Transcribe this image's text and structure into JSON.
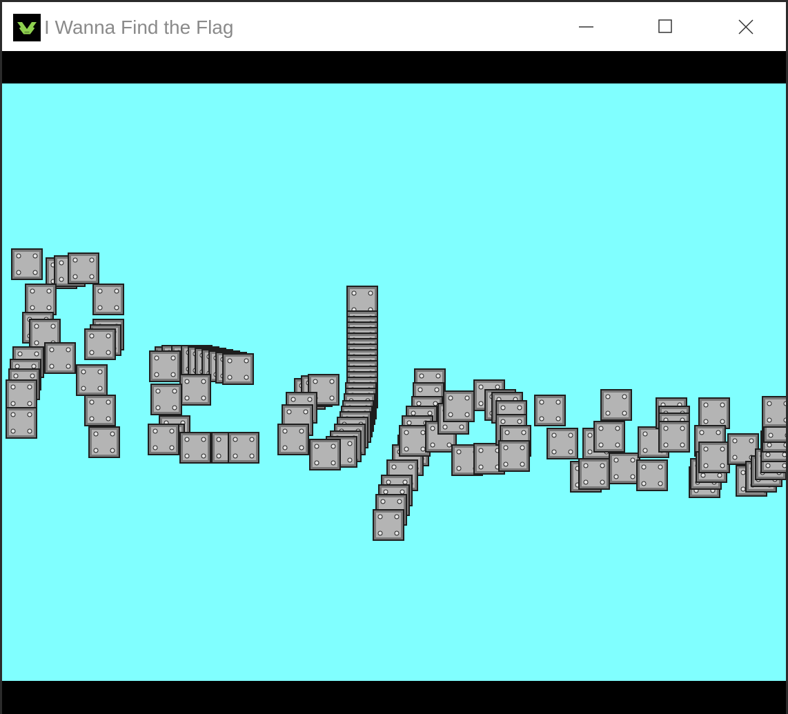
{
  "window": {
    "title": "I Wanna Find the Flag",
    "icon": "gamemaker-icon",
    "controls": [
      "minimize-icon",
      "maximize-icon",
      "close-icon"
    ]
  },
  "colors": {
    "sky": "#80ffff",
    "letterbox": "#000000",
    "block_face": "#b4b4b4",
    "block_border": "#1e1e1e",
    "block_bevel": "#7a7a7a",
    "title_text": "#8a8a8a"
  },
  "game": {
    "scene": "riveted metal blocks scattered in a wavy trail across a cyan sky",
    "sprite": "metal-block-icon"
  }
}
